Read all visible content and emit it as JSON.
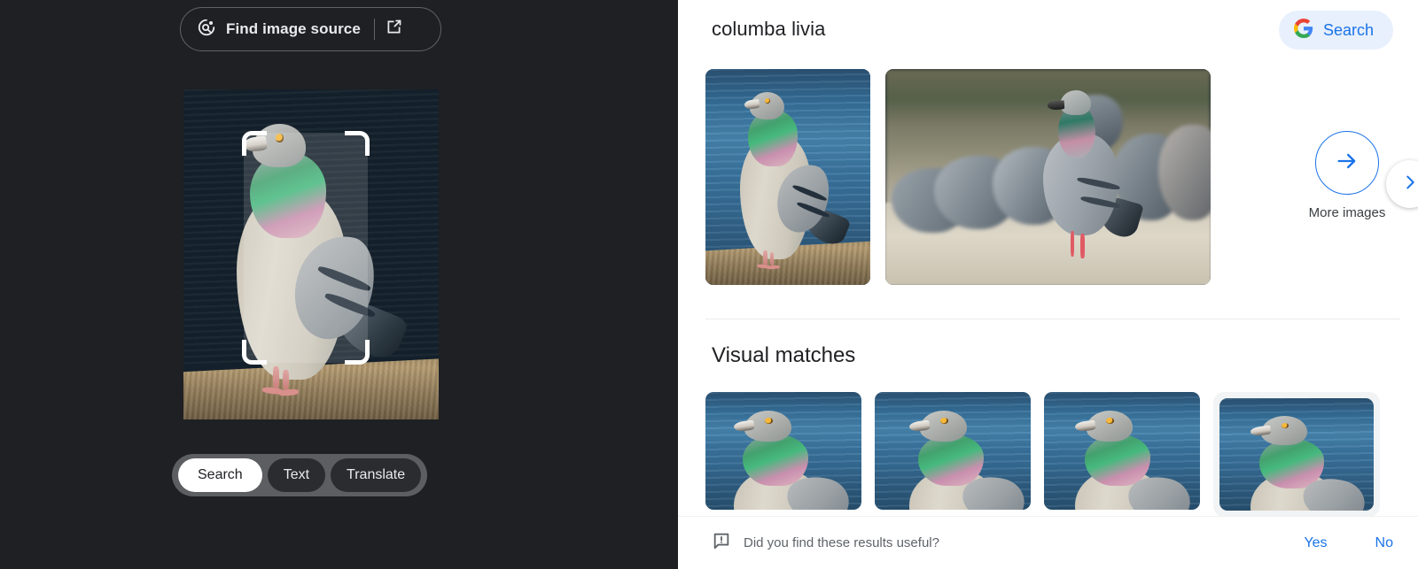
{
  "left_panel": {
    "find_image_source": {
      "label": "Find image source",
      "lens_icon": "lens-search-icon",
      "external_icon": "open-in-new-icon"
    },
    "preview": {
      "alt": "pigeon standing on a stone ledge by blue water",
      "crop_overlay": "crop-selection-brackets"
    },
    "modes": [
      {
        "label": "Search",
        "active": true
      },
      {
        "label": "Text",
        "active": false
      },
      {
        "label": "Translate",
        "active": false
      }
    ]
  },
  "right_panel": {
    "query_title": "columba livia",
    "search_button": {
      "label": "Search",
      "icon": "google-g-icon",
      "background": "#e8f0fd",
      "text_color": "#1a73e8"
    },
    "top_results": [
      {
        "alt": "pigeon on stone ledge by water",
        "kind": "water-pigeon"
      },
      {
        "alt": "pigeon standing among flock on gravel",
        "kind": "flock-pigeon"
      }
    ],
    "more_images": {
      "label": "More images",
      "arrow_icon": "arrow-right-icon",
      "accent": "#1a73e8"
    },
    "scroll_next": {
      "icon": "chevron-right-icon"
    },
    "visual_matches": {
      "title": "Visual matches",
      "items": [
        {
          "alt": "pigeon close-up on blue water",
          "hovered": false
        },
        {
          "alt": "pigeon close-up on blue water",
          "hovered": false
        },
        {
          "alt": "pigeon close-up on blue water",
          "hovered": false
        },
        {
          "alt": "pigeon close-up on blue water",
          "hovered": true
        }
      ]
    },
    "feedback": {
      "icon": "feedback-bubble-icon",
      "question": "Did you find these results useful?",
      "yes_label": "Yes",
      "no_label": "No",
      "link_color": "#1a73e8"
    }
  },
  "colors": {
    "dark_panel": "#1f2023",
    "accent_blue": "#1a73e8",
    "light_blue_chip": "#e8f0fd",
    "hover_gray": "#f1f3f4"
  }
}
